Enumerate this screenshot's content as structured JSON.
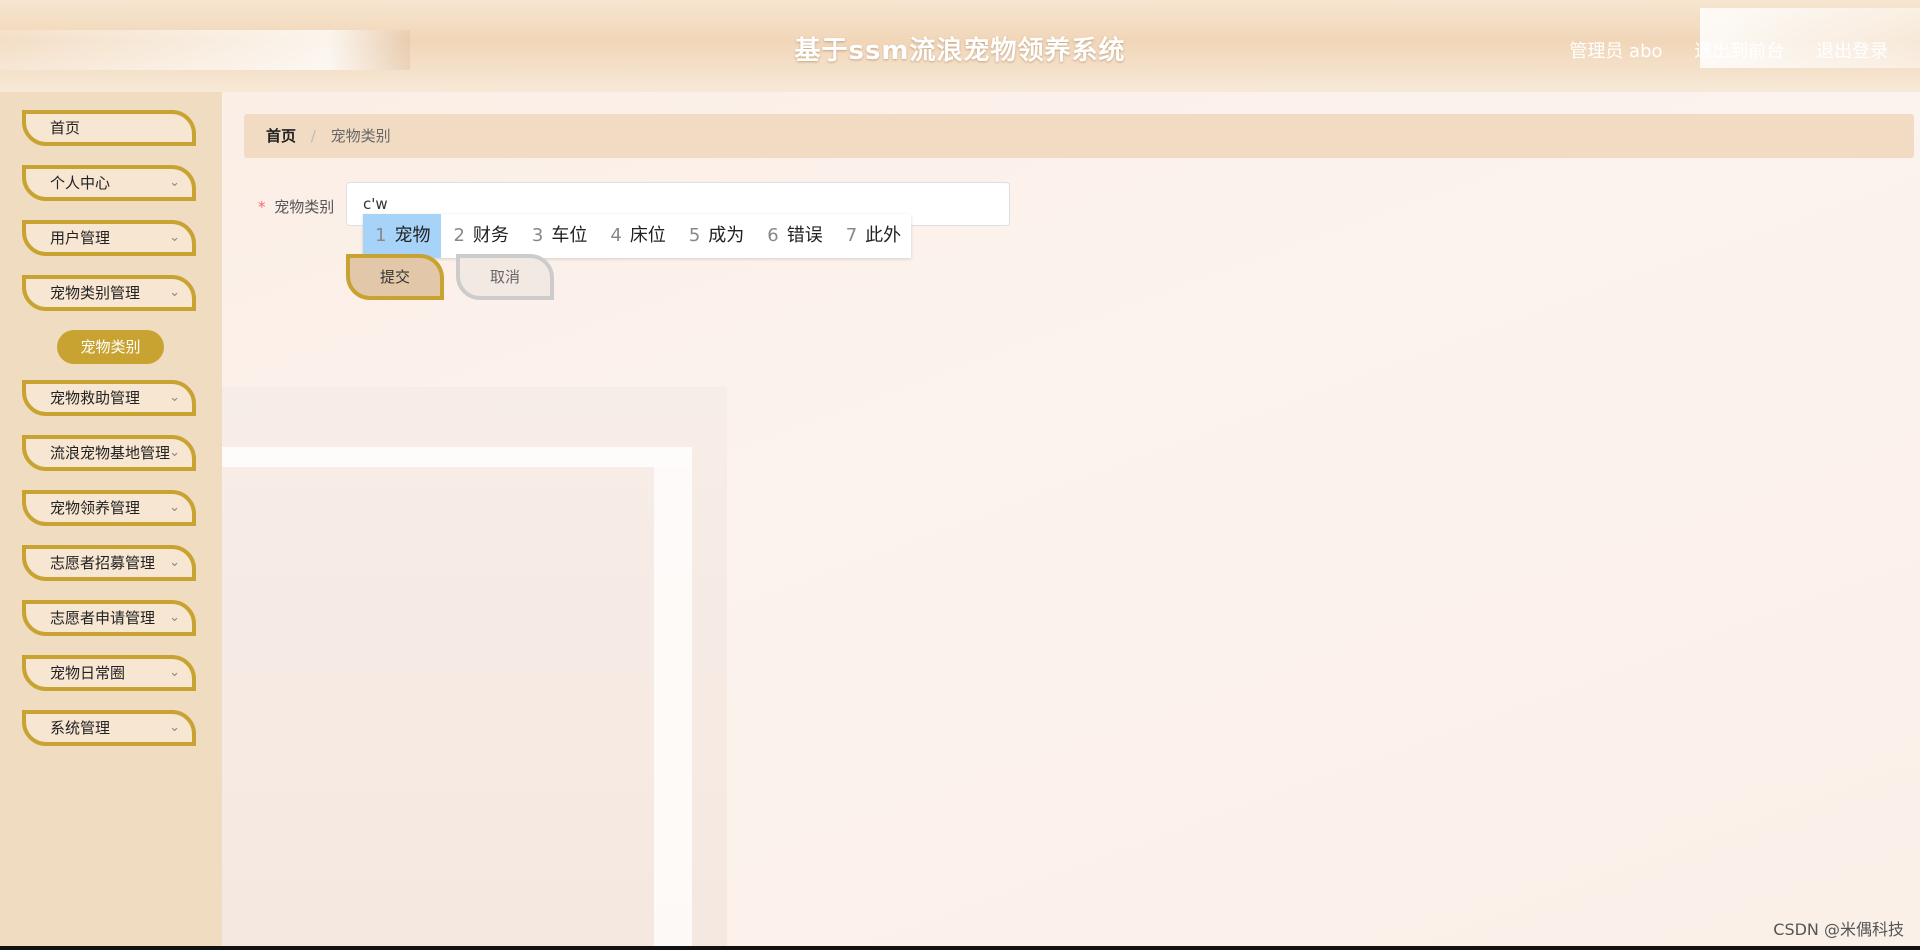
{
  "header": {
    "title": "基于ssm流浪宠物领养系统",
    "user_label": "管理员 abo",
    "front_label": "退出到前台",
    "logout_label": "退出登录"
  },
  "sidebar": {
    "items": [
      {
        "label": "首页",
        "chevron": false
      },
      {
        "label": "个人中心",
        "chevron": true
      },
      {
        "label": "用户管理",
        "chevron": true
      },
      {
        "label": "宠物类别管理",
        "chevron": true
      },
      {
        "label": "宠物救助管理",
        "chevron": true
      },
      {
        "label": "流浪宠物基地管理",
        "chevron": true
      },
      {
        "label": "宠物领养管理",
        "chevron": true
      },
      {
        "label": "志愿者招募管理",
        "chevron": true
      },
      {
        "label": "志愿者申请管理",
        "chevron": true
      },
      {
        "label": "宠物日常圈",
        "chevron": true
      },
      {
        "label": "系统管理",
        "chevron": true
      }
    ],
    "active_sub": "宠物类别",
    "chevron_icon": "chevron-down-icon"
  },
  "breadcrumb": {
    "home": "首页",
    "separator": "/",
    "current": "宠物类别"
  },
  "form": {
    "required_mark": "*",
    "label": "宠物类别",
    "value": "c'w"
  },
  "ime": {
    "candidates": [
      {
        "num": "1",
        "text": "宠物"
      },
      {
        "num": "2",
        "text": "财务"
      },
      {
        "num": "3",
        "text": "车位"
      },
      {
        "num": "4",
        "text": "床位"
      },
      {
        "num": "5",
        "text": "成为"
      },
      {
        "num": "6",
        "text": "错误"
      },
      {
        "num": "7",
        "text": "此外"
      }
    ],
    "selected_index": 0
  },
  "buttons": {
    "submit": "提交",
    "cancel": "取消"
  },
  "watermark": "CSDN @米偶科技",
  "colors": {
    "accent": "#c9a332",
    "sidebar_bg": "#f0dcc1",
    "ime_selected": "#a6d3f7"
  }
}
